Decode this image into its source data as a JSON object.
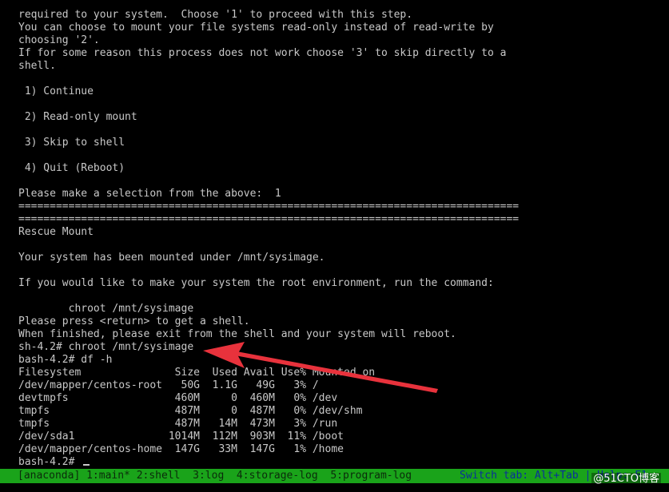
{
  "terminal": {
    "lines": [
      "required to your system.  Choose '1' to proceed with this step.",
      "You can choose to mount your file systems read-only instead of read-write by",
      "choosing '2'.",
      "If for some reason this process does not work choose '3' to skip directly to a",
      "shell.",
      "",
      " 1) Continue",
      "",
      " 2) Read-only mount",
      "",
      " 3) Skip to shell",
      "",
      " 4) Quit (Reboot)",
      "",
      "Please make a selection from the above:  1",
      "================================================================================",
      "================================================================================",
      "Rescue Mount",
      "",
      "Your system has been mounted under /mnt/sysimage.",
      "",
      "If you would like to make your system the root environment, run the command:",
      "",
      "        chroot /mnt/sysimage",
      "Please press <return> to get a shell.",
      "When finished, please exit from the shell and your system will reboot.",
      "sh-4.2# chroot /mnt/sysimage",
      "bash-4.2# df -h",
      "Filesystem               Size  Used Avail Use% Mounted on",
      "/dev/mapper/centos-root   50G  1.1G   49G   3% /",
      "devtmpfs                 460M     0  460M   0% /dev",
      "tmpfs                    487M     0  487M   0% /dev/shm",
      "tmpfs                    487M   14M  473M   3% /run",
      "/dev/sda1               1014M  112M  903M  11% /boot",
      "/dev/mapper/centos-home  147G   33M  147G   1% /home",
      "bash-4.2# "
    ]
  },
  "statusbar": {
    "tabs": "[anaconda] 1:main* 2:shell  3:log  4:storage-log  5:program-log",
    "hint": "Switch tab: Alt+Tab | Help: F1"
  },
  "watermark": "@51CTO博客",
  "colors": {
    "background": "#000000",
    "text": "#c8c8c8",
    "statusbar_bg": "#1aa31a",
    "annotation_arrow": "#e8323c"
  }
}
